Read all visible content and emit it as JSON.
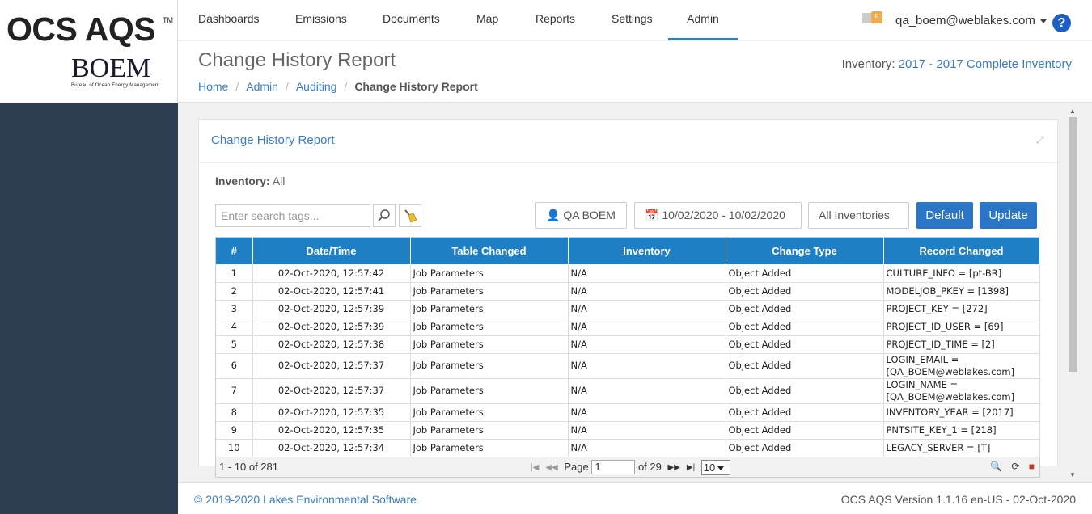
{
  "brand": {
    "app_name": "OCS AQS",
    "tm": "TM",
    "agency": "BOEM",
    "agency_full": "Bureau of Ocean Energy Management"
  },
  "nav": {
    "items": [
      {
        "label": "Dashboards"
      },
      {
        "label": "Emissions"
      },
      {
        "label": "Documents"
      },
      {
        "label": "Map"
      },
      {
        "label": "Reports"
      },
      {
        "label": "Settings"
      },
      {
        "label": "Admin",
        "active": true
      }
    ],
    "mail_count": "5",
    "user": "qa_boem@weblakes.com",
    "help": "?"
  },
  "header": {
    "title": "Change History Report",
    "breadcrumb": [
      "Home",
      "Admin",
      "Auditing",
      "Change History Report"
    ],
    "inventory_label": "Inventory:",
    "inventory_value": "2017 - 2017 Complete Inventory"
  },
  "portlet": {
    "title": "Change History Report",
    "inventory_label": "Inventory:",
    "inventory_value": "All",
    "search_placeholder": "Enter search tags...",
    "user_filter": "QA BOEM",
    "date_range": "10/02/2020 - 10/02/2020",
    "inventories_filter": "All Inventories",
    "default_label": "Default",
    "update_label": "Update"
  },
  "table": {
    "columns": [
      "#",
      "Date/Time",
      "Table Changed",
      "Inventory",
      "Change Type",
      "Record Changed"
    ],
    "rows": [
      [
        "1",
        "02-Oct-2020, 12:57:42",
        "Job Parameters",
        "N/A",
        "Object Added",
        "CULTURE_INFO = [pt-BR]"
      ],
      [
        "2",
        "02-Oct-2020, 12:57:41",
        "Job Parameters",
        "N/A",
        "Object Added",
        "MODELJOB_PKEY = [1398]"
      ],
      [
        "3",
        "02-Oct-2020, 12:57:39",
        "Job Parameters",
        "N/A",
        "Object Added",
        "PROJECT_KEY = [272]"
      ],
      [
        "4",
        "02-Oct-2020, 12:57:39",
        "Job Parameters",
        "N/A",
        "Object Added",
        "PROJECT_ID_USER = [69]"
      ],
      [
        "5",
        "02-Oct-2020, 12:57:38",
        "Job Parameters",
        "N/A",
        "Object Added",
        "PROJECT_ID_TIME = [2]"
      ],
      [
        "6",
        "02-Oct-2020, 12:57:37",
        "Job Parameters",
        "N/A",
        "Object Added",
        "LOGIN_EMAIL = [QA_BOEM@weblakes.com]"
      ],
      [
        "7",
        "02-Oct-2020, 12:57:37",
        "Job Parameters",
        "N/A",
        "Object Added",
        "LOGIN_NAME = [QA_BOEM@weblakes.com]"
      ],
      [
        "8",
        "02-Oct-2020, 12:57:35",
        "Job Parameters",
        "N/A",
        "Object Added",
        "INVENTORY_YEAR = [2017]"
      ],
      [
        "9",
        "02-Oct-2020, 12:57:35",
        "Job Parameters",
        "N/A",
        "Object Added",
        "PNTSITE_KEY_1 = [218]"
      ],
      [
        "10",
        "02-Oct-2020, 12:57:34",
        "Job Parameters",
        "N/A",
        "Object Added",
        "LEGACY_SERVER = [T]"
      ]
    ],
    "pager": {
      "count": "1 - 10 of 281",
      "page_label": "Page",
      "page_value": "1",
      "of_label": "of 29",
      "page_size": "10"
    }
  },
  "footer": {
    "copyright": "© 2019-2020 Lakes Environmental Software",
    "version": "OCS AQS Version 1.1.16 en-US - 02-Oct-2020"
  }
}
